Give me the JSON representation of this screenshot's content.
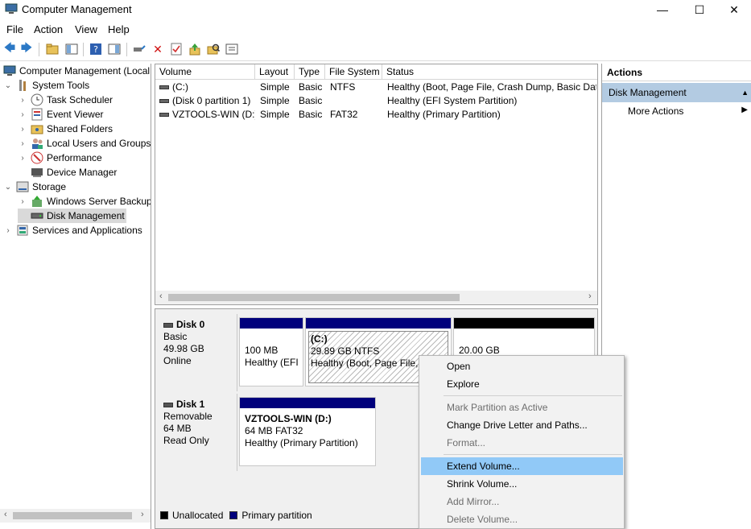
{
  "window": {
    "title": "Computer Management",
    "minimize": "—",
    "maximize": "☐",
    "close": "✕"
  },
  "menu": [
    "File",
    "Action",
    "View",
    "Help"
  ],
  "tree": [
    {
      "label": "Computer Management (Local",
      "level": 0,
      "chev": "",
      "icon": "computer-icon"
    },
    {
      "label": "System Tools",
      "level": 1,
      "chev": "⌄",
      "icon": "tools-icon"
    },
    {
      "label": "Task Scheduler",
      "level": 2,
      "chev": "›",
      "icon": "clock-icon"
    },
    {
      "label": "Event Viewer",
      "level": 2,
      "chev": "›",
      "icon": "event-log-icon"
    },
    {
      "label": "Shared Folders",
      "level": 2,
      "chev": "›",
      "icon": "shared-folder-icon"
    },
    {
      "label": "Local Users and Groups",
      "level": 2,
      "chev": "›",
      "icon": "users-icon"
    },
    {
      "label": "Performance",
      "level": 2,
      "chev": "›",
      "icon": "performance-icon"
    },
    {
      "label": "Device Manager",
      "level": 2,
      "chev": "",
      "icon": "device-manager-icon"
    },
    {
      "label": "Storage",
      "level": 1,
      "chev": "⌄",
      "icon": "storage-icon"
    },
    {
      "label": "Windows Server Backup",
      "level": 2,
      "chev": "›",
      "icon": "backup-icon"
    },
    {
      "label": "Disk Management",
      "level": 2,
      "chev": "",
      "icon": "disk-icon",
      "selected": true
    },
    {
      "label": "Services and Applications",
      "level": 1,
      "chev": "›",
      "icon": "services-icon"
    }
  ],
  "volumes": {
    "columns": [
      "Volume",
      "Layout",
      "Type",
      "File System",
      "Status"
    ],
    "rows": [
      {
        "volume": "(C:)",
        "layout": "Simple",
        "type": "Basic",
        "fs": "NTFS",
        "status": "Healthy (Boot, Page File, Crash Dump, Basic Data"
      },
      {
        "volume": "(Disk 0 partition 1)",
        "layout": "Simple",
        "type": "Basic",
        "fs": "",
        "status": "Healthy (EFI System Partition)"
      },
      {
        "volume": "VZTOOLS-WIN (D:)",
        "layout": "Simple",
        "type": "Basic",
        "fs": "FAT32",
        "status": "Healthy (Primary Partition)"
      }
    ]
  },
  "disks": [
    {
      "name": "Disk 0",
      "kind": "Basic",
      "size": "49.98 GB",
      "state": "Online",
      "partitions": [
        {
          "title": "",
          "line1": "100 MB",
          "line2": "Healthy (EFI",
          "kind": "primary"
        },
        {
          "title": "(C:)",
          "line1": "29.89 GB NTFS",
          "line2": "Healthy (Boot, Page File,",
          "kind": "primary-selected"
        },
        {
          "title": "",
          "line1": "20.00 GB",
          "line2": "",
          "kind": "unallocated"
        }
      ]
    },
    {
      "name": "Disk 1",
      "kind": "Removable",
      "size": "64 MB",
      "state": "Read Only",
      "partitions": [
        {
          "title": "VZTOOLS-WIN  (D:)",
          "line1": "64 MB FAT32",
          "line2": "Healthy (Primary Partition)",
          "kind": "primary"
        }
      ]
    }
  ],
  "legend": [
    {
      "label": "Unallocated",
      "color": "#000000"
    },
    {
      "label": "Primary partition",
      "color": "#00007c"
    }
  ],
  "actions": {
    "header": "Actions",
    "section": "Disk Management",
    "more": "More Actions"
  },
  "context_menu": [
    {
      "label": "Open",
      "disabled": false
    },
    {
      "label": "Explore",
      "disabled": false
    },
    {
      "sep": true
    },
    {
      "label": "Mark Partition as Active",
      "disabled": true
    },
    {
      "label": "Change Drive Letter and Paths...",
      "disabled": false
    },
    {
      "label": "Format...",
      "disabled": true
    },
    {
      "sep": true
    },
    {
      "label": "Extend Volume...",
      "disabled": false,
      "highlighted": true
    },
    {
      "label": "Shrink Volume...",
      "disabled": false
    },
    {
      "label": "Add Mirror...",
      "disabled": true
    },
    {
      "label": "Delete Volume...",
      "disabled": true
    }
  ],
  "colors": {
    "primary": "#00007c",
    "unallocated": "#000000",
    "section": "#b3cbe2",
    "highlight": "#91c9f7"
  }
}
